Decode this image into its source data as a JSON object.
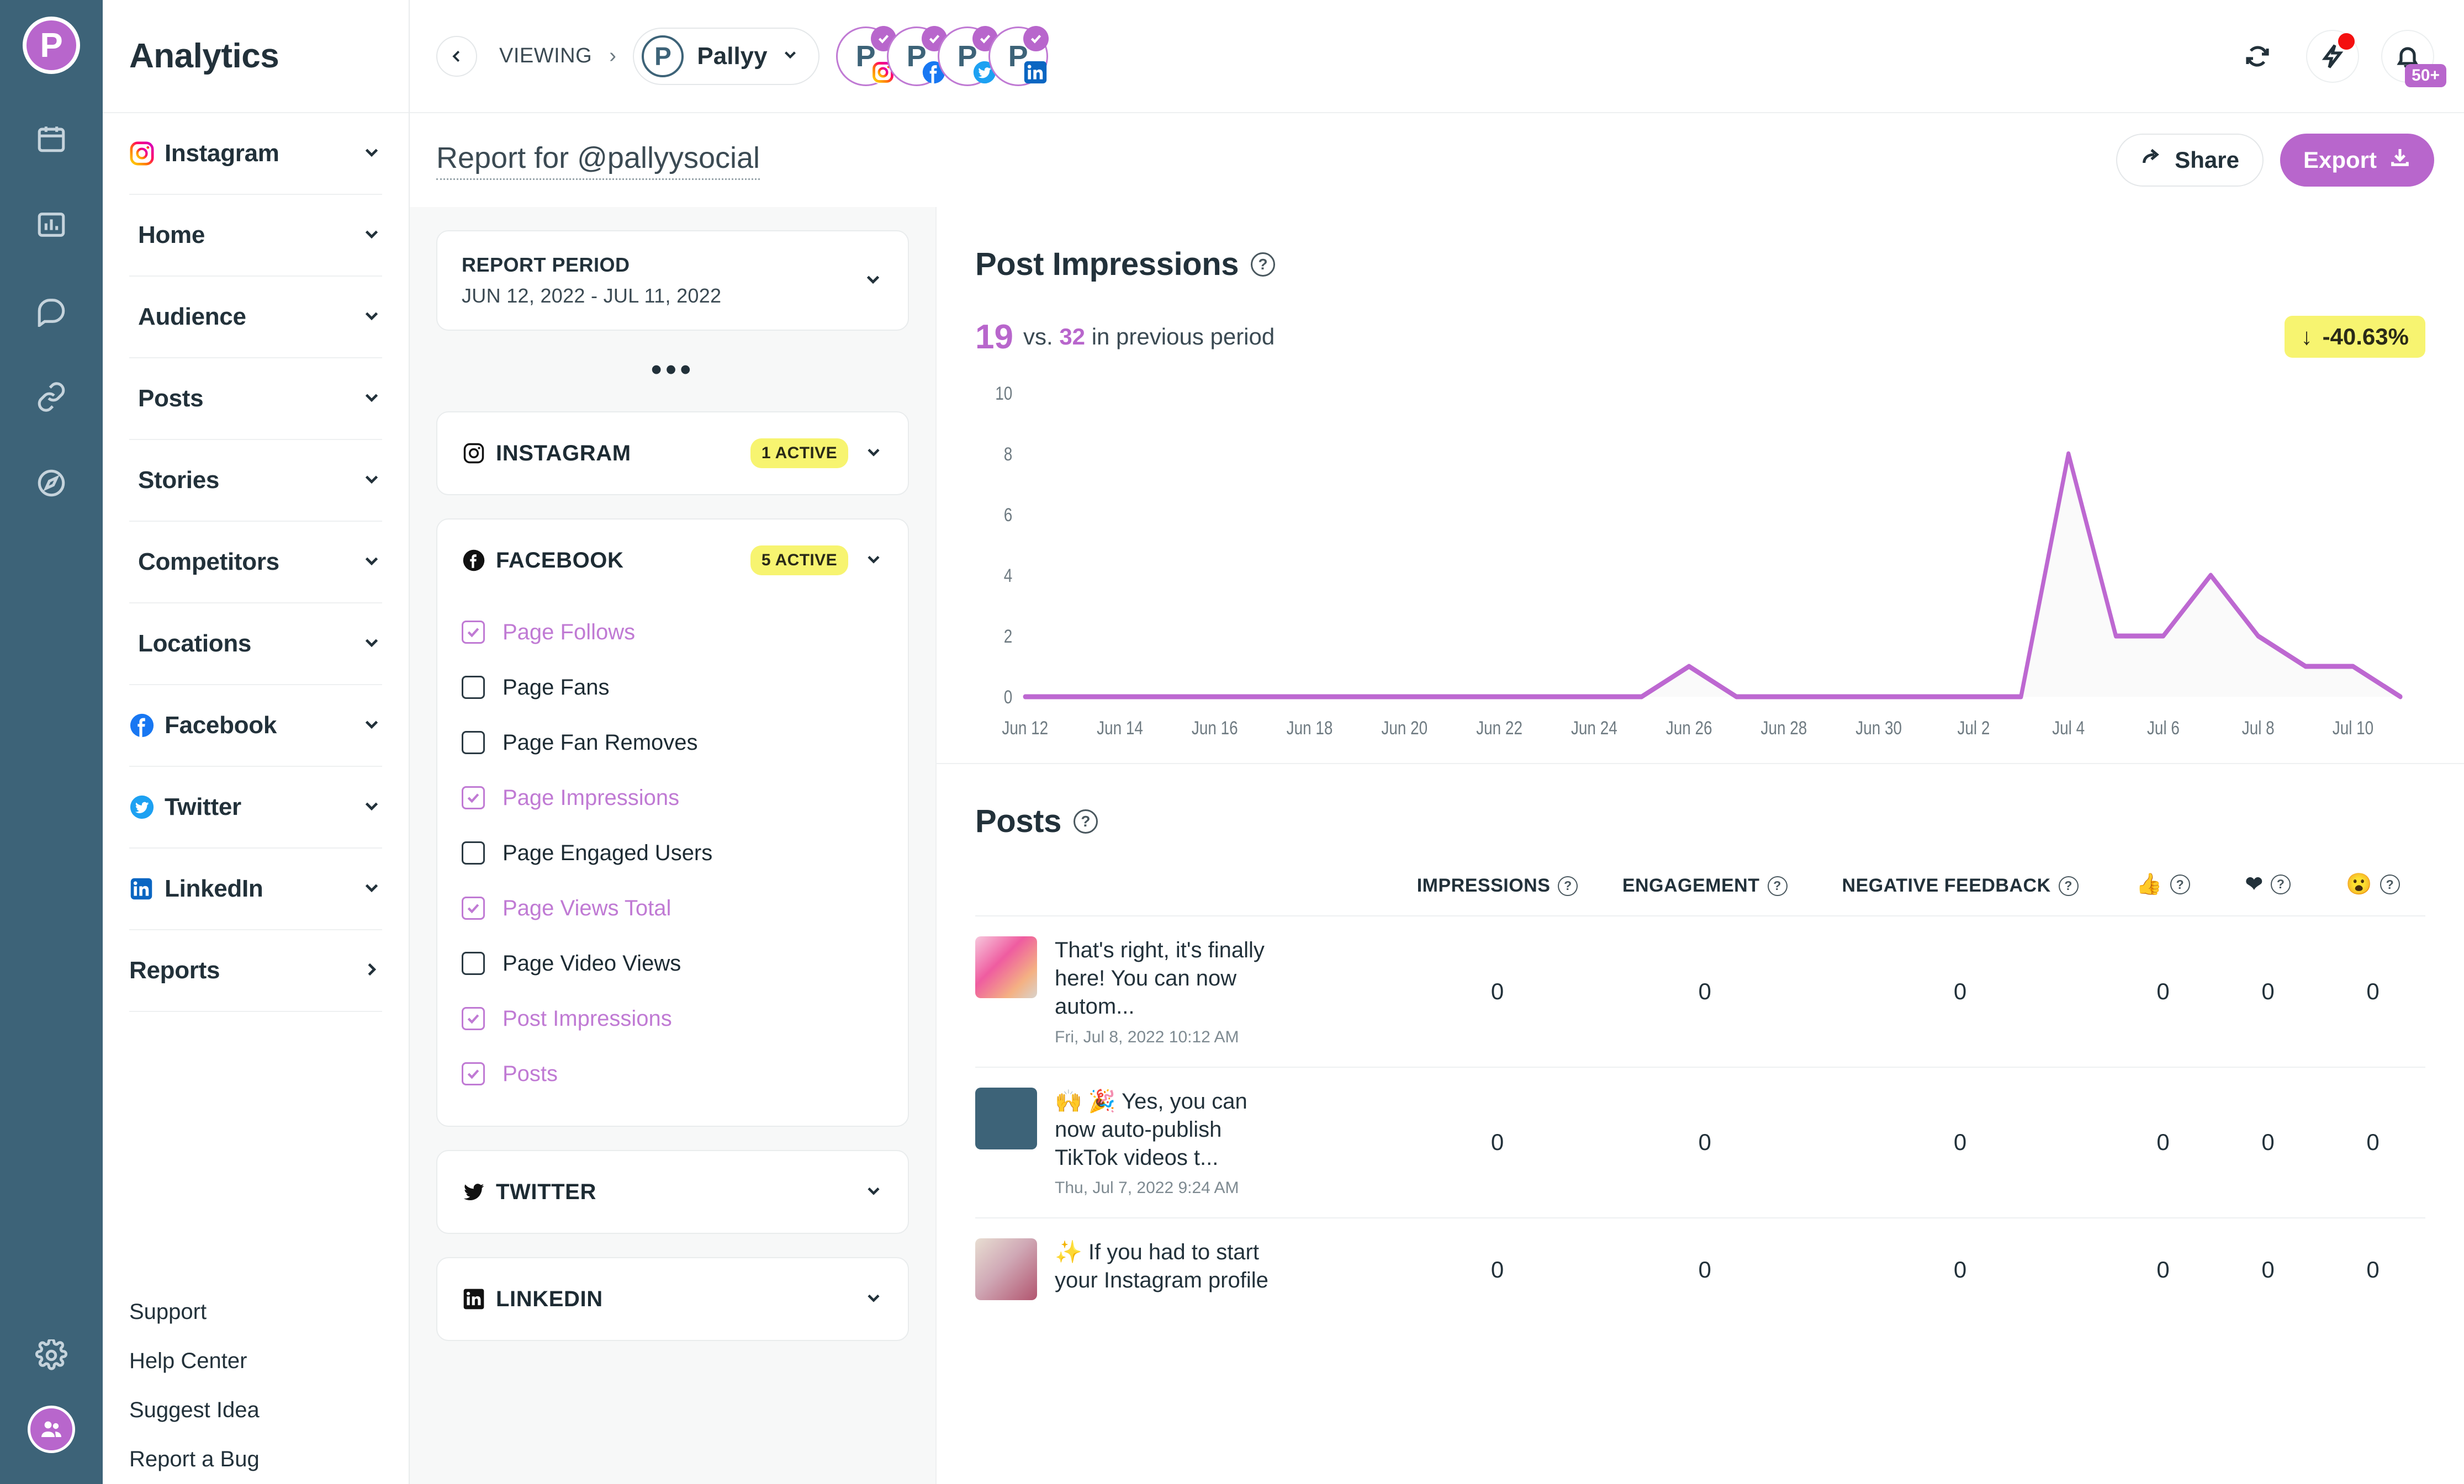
{
  "brand": {
    "logo_letter": "P",
    "app_title": "Analytics",
    "accent": "#b866cc",
    "rail_bg": "#3d6378"
  },
  "rail": {
    "items": [
      {
        "name": "calendar-icon"
      },
      {
        "name": "chart-icon"
      },
      {
        "name": "comments-icon"
      },
      {
        "name": "link-icon"
      },
      {
        "name": "compass-icon"
      }
    ],
    "bottom": [
      {
        "name": "gear-icon"
      },
      {
        "name": "team-avatar"
      }
    ]
  },
  "sidebar": {
    "title": "Analytics",
    "groups": [
      {
        "label": "Instagram",
        "icon": "instagram-icon",
        "chevron": "down"
      },
      {
        "label": "Home",
        "icon": "",
        "chevron": "down"
      },
      {
        "label": "Audience",
        "icon": "",
        "chevron": "down"
      },
      {
        "label": "Posts",
        "icon": "",
        "chevron": "down"
      },
      {
        "label": "Stories",
        "icon": "",
        "chevron": "down"
      },
      {
        "label": "Competitors",
        "icon": "",
        "chevron": "down"
      },
      {
        "label": "Locations",
        "icon": "",
        "chevron": "down"
      },
      {
        "label": "Facebook",
        "icon": "facebook-icon",
        "chevron": "down"
      },
      {
        "label": "Twitter",
        "icon": "twitter-icon",
        "chevron": "down"
      },
      {
        "label": "LinkedIn",
        "icon": "linkedin-icon",
        "chevron": "down"
      },
      {
        "label": "Reports",
        "icon": "",
        "chevron": "right"
      }
    ],
    "links": [
      "Support",
      "Help Center",
      "Suggest Idea",
      "Report a Bug"
    ]
  },
  "topbar": {
    "viewing_label": "VIEWING",
    "viewing_sep": "›",
    "workspace": "Pallyy",
    "workspace_avatar_letter": "P",
    "accounts": [
      {
        "avatar_letter": "P",
        "network": "instagram",
        "verified": true
      },
      {
        "avatar_letter": "P",
        "network": "facebook",
        "verified": true
      },
      {
        "avatar_letter": "P",
        "network": "twitter",
        "verified": true
      },
      {
        "avatar_letter": "P",
        "network": "linkedin",
        "verified": true
      }
    ],
    "refresh_icon": "refresh-icon",
    "bolt_icon": "bolt-icon",
    "bell_icon": "bell-icon",
    "notification_count": "50+"
  },
  "report_header": {
    "title": "Report for @pallyysocial",
    "share_label": "Share",
    "export_label": "Export"
  },
  "filters": {
    "period": {
      "label": "REPORT PERIOD",
      "value": "JUN 12, 2022 - JUL 11, 2022"
    },
    "dots": "•••",
    "networks": [
      {
        "name": "INSTAGRAM",
        "icon": "instagram-icon",
        "badge": "1 ACTIVE",
        "metrics": []
      },
      {
        "name": "FACEBOOK",
        "icon": "facebook-icon",
        "badge": "5 ACTIVE",
        "metrics": [
          {
            "label": "Page Follows",
            "checked": true
          },
          {
            "label": "Page Fans",
            "checked": false
          },
          {
            "label": "Page Fan Removes",
            "checked": false
          },
          {
            "label": "Page Impressions",
            "checked": true
          },
          {
            "label": "Page Engaged Users",
            "checked": false
          },
          {
            "label": "Page Views Total",
            "checked": true
          },
          {
            "label": "Page Video Views",
            "checked": false
          },
          {
            "label": "Post Impressions",
            "checked": true
          },
          {
            "label": "Posts",
            "checked": true
          }
        ]
      },
      {
        "name": "TWITTER",
        "icon": "twitter-icon",
        "badge": "",
        "metrics": []
      },
      {
        "name": "LINKEDIN",
        "icon": "linkedin-icon",
        "badge": "",
        "metrics": []
      }
    ]
  },
  "impressions_section": {
    "title": "Post Impressions",
    "current_value": "19",
    "vs_prefix": "vs.",
    "previous_value": "32",
    "vs_suffix": "in previous period",
    "change_arrow": "↓",
    "change_value": "-40.63%"
  },
  "posts_section": {
    "title": "Posts",
    "columns": [
      {
        "label": "IMPRESSIONS",
        "help": true,
        "icon": ""
      },
      {
        "label": "ENGAGEMENT",
        "help": true,
        "icon": ""
      },
      {
        "label": "NEGATIVE FEEDBACK",
        "help": true,
        "icon": ""
      },
      {
        "label": "",
        "help": true,
        "icon": "thumbs-up-icon"
      },
      {
        "label": "",
        "help": true,
        "icon": "heart-icon"
      },
      {
        "label": "",
        "help": true,
        "icon": "wow-face-icon"
      }
    ],
    "rows": [
      {
        "title": "That's right, it's finally here! You can now autom...",
        "date": "Fri, Jul 8, 2022 10:12 AM",
        "impressions": "0",
        "engagement": "0",
        "negative_feedback": "0",
        "likes": "0",
        "loves": "0",
        "wows": "0"
      },
      {
        "title": "🙌 🎉 Yes, you can now auto-publish TikTok videos t...",
        "date": "Thu, Jul 7, 2022 9:24 AM",
        "impressions": "0",
        "engagement": "0",
        "negative_feedback": "0",
        "likes": "0",
        "loves": "0",
        "wows": "0"
      },
      {
        "title": "✨ If you had to start your Instagram profile",
        "date": "",
        "impressions": "0",
        "engagement": "0",
        "negative_feedback": "0",
        "likes": "0",
        "loves": "0",
        "wows": "0"
      }
    ]
  },
  "chart_data": {
    "type": "area",
    "title": "Post Impressions",
    "xlabel": "",
    "ylabel": "",
    "ylim": [
      0,
      10
    ],
    "yticks": [
      0,
      2,
      4,
      6,
      8,
      10
    ],
    "grid": false,
    "legend": null,
    "line_color": "#bd68d1",
    "fill_color": "#fafafa",
    "x": [
      "Jun 12",
      "Jun 13",
      "Jun 14",
      "Jun 15",
      "Jun 16",
      "Jun 17",
      "Jun 18",
      "Jun 19",
      "Jun 20",
      "Jun 21",
      "Jun 22",
      "Jun 23",
      "Jun 24",
      "Jun 25",
      "Jun 26",
      "Jun 27",
      "Jun 28",
      "Jun 29",
      "Jun 30",
      "Jul 1",
      "Jul 2",
      "Jul 3",
      "Jul 4",
      "Jul 5",
      "Jul 6",
      "Jul 7",
      "Jul 8",
      "Jul 9",
      "Jul 10",
      "Jul 11"
    ],
    "xtick_labels": [
      "Jun 12",
      "Jun 14",
      "Jun 16",
      "Jun 18",
      "Jun 20",
      "Jun 22",
      "Jun 24",
      "Jun 26",
      "Jun 28",
      "Jun 30",
      "Jul 2",
      "Jul 4",
      "Jul 6",
      "Jul 8",
      "Jul 10"
    ],
    "series": [
      {
        "name": "Post Impressions",
        "values": [
          0,
          0,
          0,
          0,
          0,
          0,
          0,
          0,
          0,
          0,
          0,
          0,
          0,
          0,
          1,
          0,
          0,
          0,
          0,
          0,
          0,
          0,
          8,
          2,
          2,
          4,
          2,
          1,
          1,
          0
        ]
      }
    ]
  }
}
